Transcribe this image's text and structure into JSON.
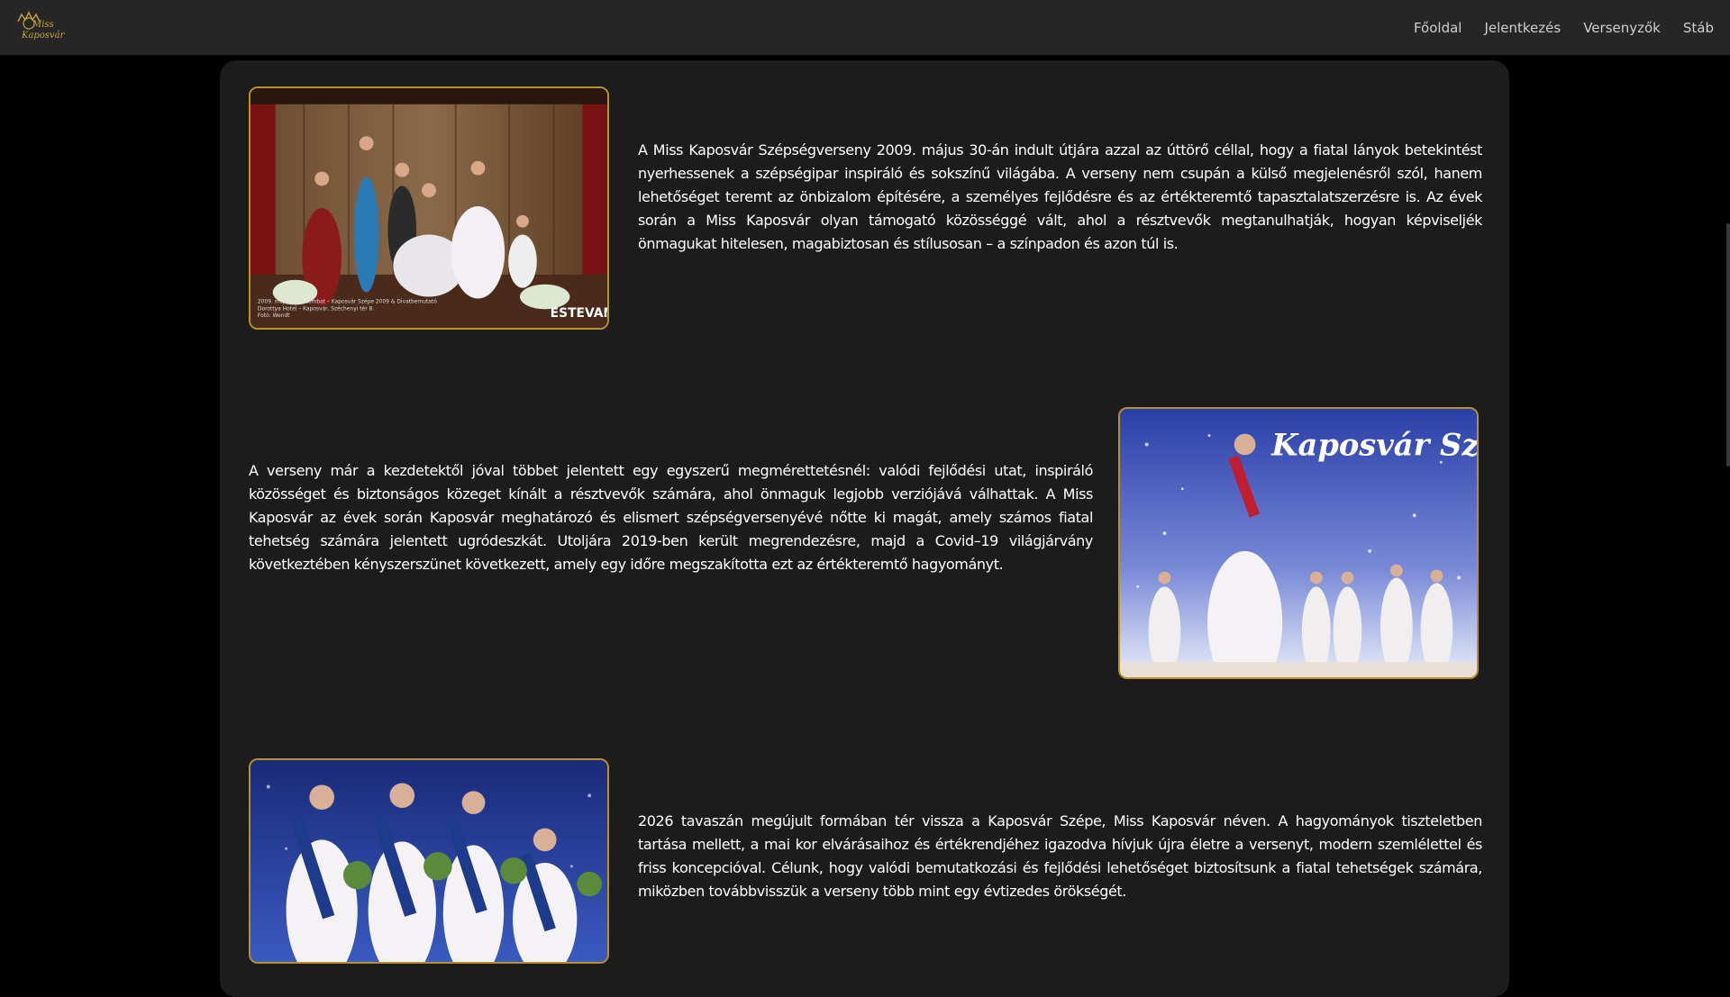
{
  "header": {
    "logo_text_line1": "Miss",
    "logo_text_line2": "Kaposvár",
    "nav": [
      {
        "label": "Főoldal"
      },
      {
        "label": "Jelentkezés"
      },
      {
        "label": "Versenyzők"
      },
      {
        "label": "Stáb"
      }
    ]
  },
  "sections": [
    {
      "text": "A Miss Kaposvár Szépségverseny 2009. május 30-án indult útjára azzal az úttörő céllal, hogy a fiatal lányok betekintést nyerhessenek a szépségipar inspiráló és sokszínű világába. A verseny nem csupán a külső megjelenésről szól, hanem lehetőséget teremt az önbizalom építésére, a személyes fejlődésre és az értékteremtő tapasztalatszerzésre is. Az évek során a Miss Kaposvár olyan támogató közösséggé vált, ahol a résztvevők megtanulhatják, hogyan képviseljék önmagukat hitelesen, magabiztosan és stílusosan – a színpadon és azon túl is.",
      "photo_caption": "2009. május 30. szombat – Kaposvár Szépe 2009 & Divatbemutató\nDorottya Hotel – Kaposvár, Széchenyi tér 8.\nFotó: Wendt",
      "photo_watermark": "ESTEVAN"
    },
    {
      "text": "A verseny már a kezdetektől jóval többet jelentett egy egyszerű megmérettetésnél: valódi fejlődési utat, inspiráló közösséget és biztonságos közeget kínált a résztvevők számára, ahol önmaguk legjobb verziójává válhattak. A Miss Kaposvár az évek során Kaposvár meghatározó és elismert szépségversenyévé nőtte ki magát, amely számos fiatal tehetség számára jelentett ugródeszkát. Utoljára 2019-ben került megrendezésre, majd a Covid–19 világjárvány következtében kényszerszünet következett, amely egy időre megszakította ezt az értékteremtő hagyományt.",
      "photo_banner": "Kaposvár Szépe"
    },
    {
      "text": "2026 tavaszán megújult formában tér vissza a Kaposvár Szépe, Miss Kaposvár néven. A hagyományok tiszteletben tartása mellett, a mai kor elvárásaihoz és értékrendjéhez igazodva hívjuk újra életre a versenyt, modern szemlélettel és friss koncepcióval. Célunk, hogy valódi bemutatkozási és fejlődési lehetőséget biztosítsunk a fiatal tehetségek számára, miközben továbbvisszük a verseny több mint egy évtizedes örökségét."
    }
  ],
  "colors": {
    "gold": "#b8912f",
    "nav_bg": "#262626",
    "card_bg": "#1c1c1c",
    "page_bg": "#000000"
  }
}
